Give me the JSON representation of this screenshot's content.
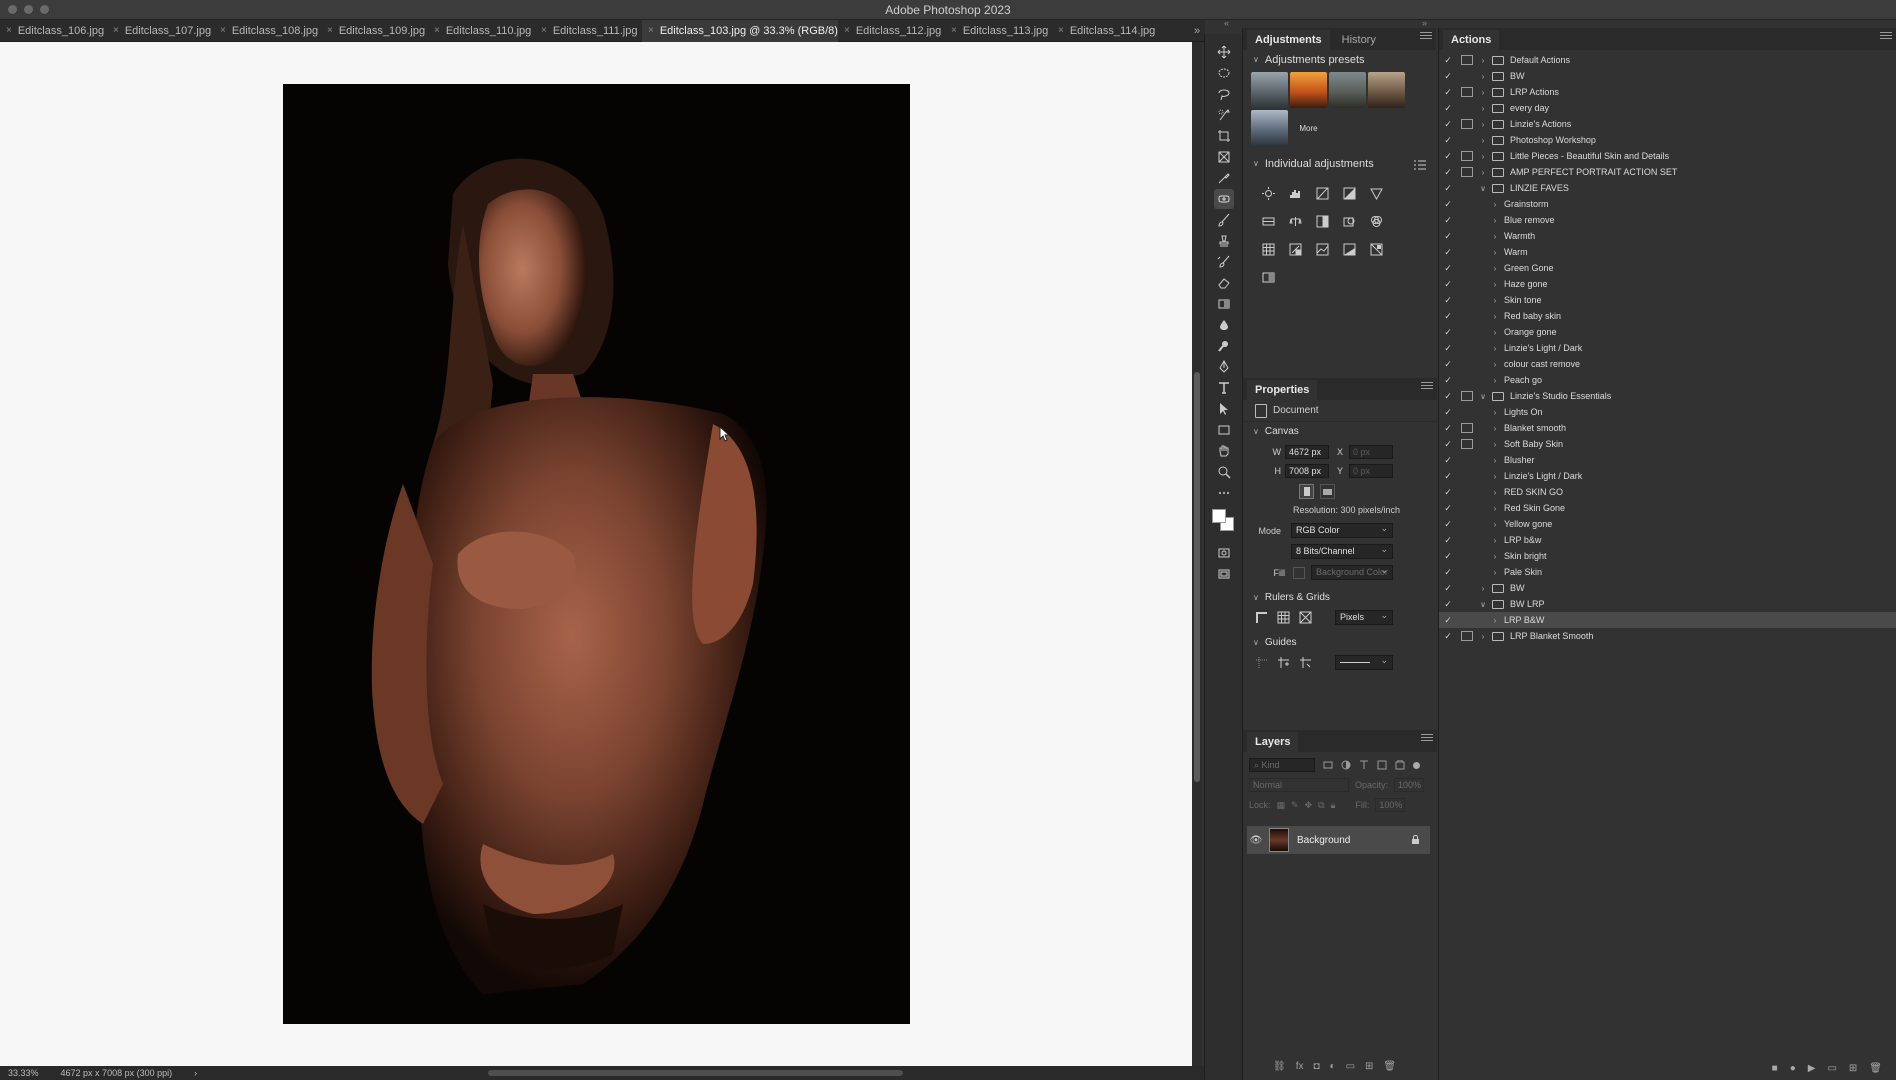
{
  "window": {
    "title": "Adobe Photoshop 2023"
  },
  "tabs": [
    {
      "label": "Editclass_106.jpg",
      "active": false
    },
    {
      "label": "Editclass_107.jpg",
      "active": false
    },
    {
      "label": "Editclass_108.jpg",
      "active": false
    },
    {
      "label": "Editclass_109.jpg",
      "active": false
    },
    {
      "label": "Editclass_110.jpg",
      "active": false
    },
    {
      "label": "Editclass_111.jpg",
      "active": false
    },
    {
      "label": "Editclass_103.jpg @ 33.3% (RGB/8) *",
      "active": true
    },
    {
      "label": "Editclass_112.jpg",
      "active": false
    },
    {
      "label": "Editclass_113.jpg",
      "active": false
    },
    {
      "label": "Editclass_114.jpg",
      "active": false
    }
  ],
  "tab_overflow": "»",
  "status": {
    "zoom": "33.33%",
    "doc_info": "4672 px x 7008 px (300 ppi)",
    "arrow": "›"
  },
  "adjustments": {
    "tabs": [
      "Adjustments",
      "History"
    ],
    "presets_title": "Adjustments presets",
    "presets_more": "More",
    "individual_title": "Individual adjustments"
  },
  "properties": {
    "tab": "Properties",
    "doc_label": "Document",
    "canvas_title": "Canvas",
    "w_label": "W",
    "w_value": "4672 px",
    "h_label": "H",
    "h_value": "7008 px",
    "x_label": "X",
    "y_label": "Y",
    "x_value": "0 px",
    "y_value": "0 px",
    "resolution": "Resolution: 300 pixels/inch",
    "mode_label": "Mode",
    "mode_value": "RGB Color",
    "bits_value": "8 Bits/Channel",
    "fill_label": "Fill",
    "fill_value": "Background Color",
    "rulers_title": "Rulers & Grids",
    "units_value": "Pixels",
    "guides_title": "Guides"
  },
  "layers": {
    "tab": "Layers",
    "kind_placeholder": "Kind",
    "blend_mode": "Normal",
    "opacity_label": "Opacity:",
    "opacity_value": "100%",
    "lock_label": "Lock:",
    "fill_label": "Fill:",
    "fill_value": "100%",
    "layer_name": "Background"
  },
  "actions": {
    "tab": "Actions",
    "items": [
      {
        "label": "Default Actions",
        "folder": true,
        "level": 0,
        "dialog": true,
        "expanded": false
      },
      {
        "label": "BW",
        "folder": true,
        "level": 0,
        "dialog": false,
        "expanded": false
      },
      {
        "label": "LRP Actions",
        "folder": true,
        "level": 0,
        "dialog": true,
        "expanded": false
      },
      {
        "label": "every day",
        "folder": true,
        "level": 0,
        "dialog": false,
        "expanded": false
      },
      {
        "label": "Linzie's Actions",
        "folder": true,
        "level": 0,
        "dialog": true,
        "expanded": false
      },
      {
        "label": "Photoshop Workshop",
        "folder": true,
        "level": 0,
        "dialog": false,
        "expanded": false
      },
      {
        "label": "Little Pieces - Beautiful Skin and Details",
        "folder": true,
        "level": 0,
        "dialog": true,
        "expanded": false
      },
      {
        "label": "AMP PERFECT PORTRAIT ACTION SET",
        "folder": true,
        "level": 0,
        "dialog": true,
        "expanded": false
      },
      {
        "label": "LINZIE FAVES",
        "folder": true,
        "level": 0,
        "dialog": false,
        "expanded": true
      },
      {
        "label": "Grainstorm",
        "folder": false,
        "level": 1,
        "dialog": false
      },
      {
        "label": "Blue remove",
        "folder": false,
        "level": 1,
        "dialog": false
      },
      {
        "label": "Warmth",
        "folder": false,
        "level": 1,
        "dialog": false
      },
      {
        "label": "Warm",
        "folder": false,
        "level": 1,
        "dialog": false
      },
      {
        "label": "Green Gone",
        "folder": false,
        "level": 1,
        "dialog": false
      },
      {
        "label": "Haze gone",
        "folder": false,
        "level": 1,
        "dialog": false
      },
      {
        "label": "Skin tone",
        "folder": false,
        "level": 1,
        "dialog": false
      },
      {
        "label": "Red baby skin",
        "folder": false,
        "level": 1,
        "dialog": false
      },
      {
        "label": "Orange gone",
        "folder": false,
        "level": 1,
        "dialog": false
      },
      {
        "label": "Linzie's Light / Dark",
        "folder": false,
        "level": 1,
        "dialog": false
      },
      {
        "label": "colour cast remove",
        "folder": false,
        "level": 1,
        "dialog": false
      },
      {
        "label": "Peach go",
        "folder": false,
        "level": 1,
        "dialog": false
      },
      {
        "label": "Linzie's Studio Essentials",
        "folder": true,
        "level": 0,
        "dialog": true,
        "expanded": true
      },
      {
        "label": "Lights On",
        "folder": false,
        "level": 1,
        "dialog": false
      },
      {
        "label": "Blanket smooth",
        "folder": false,
        "level": 1,
        "dialog": true
      },
      {
        "label": "Soft Baby Skin",
        "folder": false,
        "level": 1,
        "dialog": true
      },
      {
        "label": "Blusher",
        "folder": false,
        "level": 1,
        "dialog": false
      },
      {
        "label": "Linzie's Light / Dark",
        "folder": false,
        "level": 1,
        "dialog": false
      },
      {
        "label": "RED SKIN GO",
        "folder": false,
        "level": 1,
        "dialog": false
      },
      {
        "label": "Red Skin Gone",
        "folder": false,
        "level": 1,
        "dialog": false
      },
      {
        "label": "Yellow gone",
        "folder": false,
        "level": 1,
        "dialog": false
      },
      {
        "label": "LRP b&w",
        "folder": false,
        "level": 1,
        "dialog": false
      },
      {
        "label": "Skin bright",
        "folder": false,
        "level": 1,
        "dialog": false
      },
      {
        "label": "Pale Skin",
        "folder": false,
        "level": 1,
        "dialog": false
      },
      {
        "label": "BW",
        "folder": true,
        "level": 0,
        "dialog": false,
        "expanded": false
      },
      {
        "label": "BW LRP",
        "folder": true,
        "level": 0,
        "dialog": false,
        "expanded": true
      },
      {
        "label": "LRP B&W",
        "folder": false,
        "level": 1,
        "dialog": false,
        "selected": true
      },
      {
        "label": "LRP Blanket Smooth",
        "folder": true,
        "level": 0,
        "dialog": true,
        "expanded": false
      }
    ]
  },
  "colors": {
    "accent": "#2d6bd6",
    "panel_bg": "#323232",
    "canvas_bg": "#f7f7f7"
  }
}
